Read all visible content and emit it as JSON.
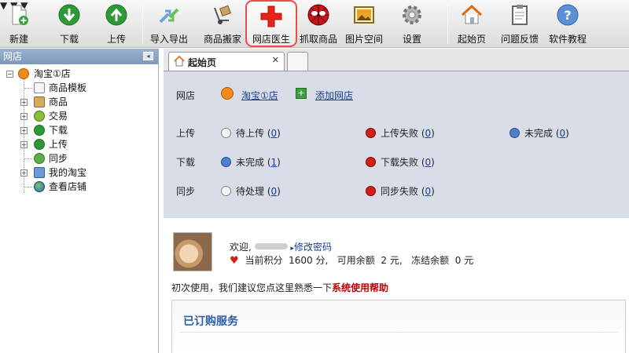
{
  "toolbar": {
    "items": [
      {
        "label": "新建",
        "icon": "new-file-icon"
      },
      {
        "label": "下载",
        "icon": "download-icon"
      },
      {
        "label": "上传",
        "icon": "upload-icon"
      },
      {
        "label": "导入导出",
        "icon": "import-export-icon"
      },
      {
        "label": "商品搬家",
        "icon": "hand-truck-icon"
      },
      {
        "label": "网店医生",
        "icon": "red-cross-icon"
      },
      {
        "label": "抓取商品",
        "icon": "spider-icon"
      },
      {
        "label": "图片空间",
        "icon": "picture-icon"
      },
      {
        "label": "设置",
        "icon": "gear-icon"
      },
      {
        "label": "起始页",
        "icon": "home-icon"
      },
      {
        "label": "问题反馈",
        "icon": "clipboard-icon"
      },
      {
        "label": "软件教程",
        "icon": "help-icon"
      }
    ]
  },
  "left_panel": {
    "title": "网店",
    "tree": {
      "root": "淘宝①店",
      "children": [
        "商品模板",
        "商品",
        "交易",
        "下载",
        "上传",
        "同步",
        "我的淘宝",
        "查看店铺"
      ]
    }
  },
  "tabs": {
    "active_label": "起始页",
    "close_glyph": "✕"
  },
  "summary": {
    "store_row": {
      "label": "网店",
      "store_link": "淘宝①店",
      "add_link": "添加网店"
    },
    "upload": {
      "label": "上传",
      "items": [
        {
          "text": "待上传",
          "count": "0"
        },
        {
          "text": "上传失败",
          "count": "0"
        },
        {
          "text": "未完成",
          "count": "0"
        }
      ]
    },
    "download": {
      "label": "下载",
      "items": [
        {
          "text": "未完成",
          "count": "1"
        },
        {
          "text": "下载失败",
          "count": "0"
        }
      ]
    },
    "sync": {
      "label": "同步",
      "items": [
        {
          "text": "待处理",
          "count": "0"
        },
        {
          "text": "同步失败",
          "count": "0"
        }
      ]
    }
  },
  "welcome": {
    "greeting": "欢迎,",
    "change_password": "修改密码",
    "points_label": "当前积分",
    "points_value": "1600 分,",
    "balance_label": "可用余额",
    "balance_value": "2 元,",
    "frozen_label": "冻结余额",
    "frozen_value": "0 元",
    "hint_text": "初次使用，我们建议您点这里熟悉一下",
    "hint_link": "系统使用帮助",
    "services_title": "已订购服务"
  },
  "colors": {
    "accent_red": "#d0201a",
    "link_blue": "#1a3d8f",
    "panel_bg": "#d8dde7",
    "highlight_border": "#f04b4b"
  }
}
